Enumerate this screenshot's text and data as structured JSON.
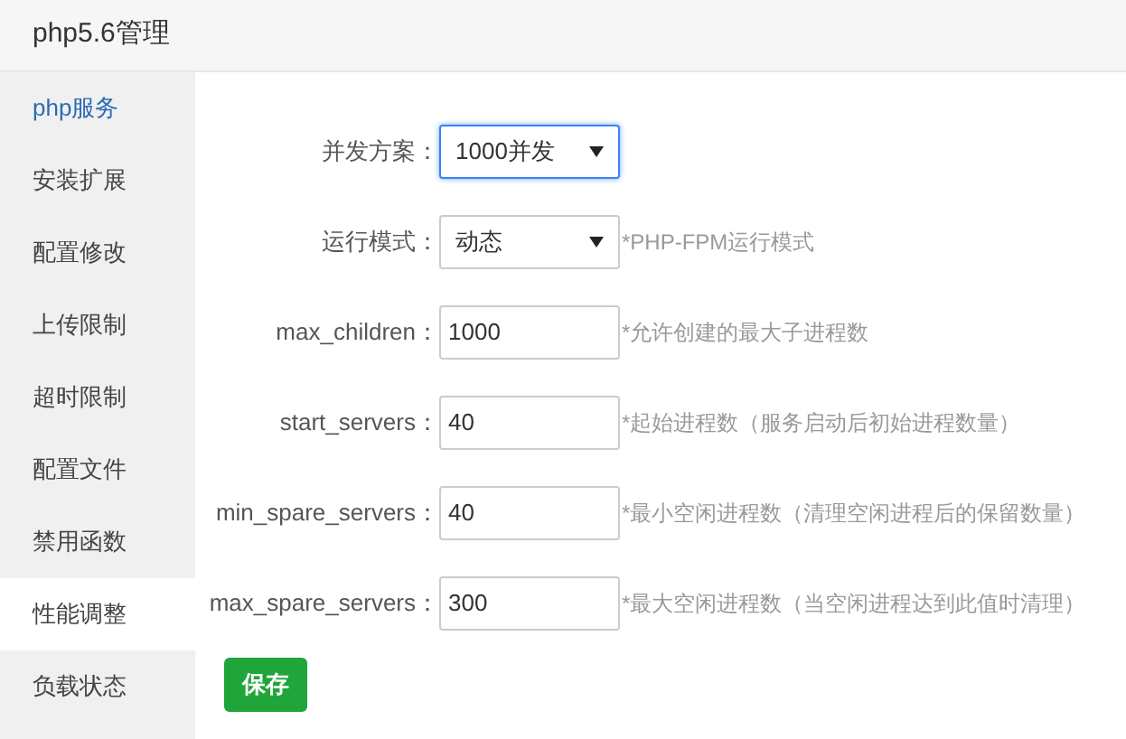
{
  "window": {
    "title": "php5.6管理"
  },
  "sidebar": {
    "items": [
      {
        "label": "php服务",
        "selected": false,
        "highlighted": true
      },
      {
        "label": "安装扩展",
        "selected": false,
        "highlighted": false
      },
      {
        "label": "配置修改",
        "selected": false,
        "highlighted": false
      },
      {
        "label": "上传限制",
        "selected": false,
        "highlighted": false
      },
      {
        "label": "超时限制",
        "selected": false,
        "highlighted": false
      },
      {
        "label": "配置文件",
        "selected": false,
        "highlighted": false
      },
      {
        "label": "禁用函数",
        "selected": false,
        "highlighted": false
      },
      {
        "label": "性能调整",
        "selected": true,
        "highlighted": false
      },
      {
        "label": "负载状态",
        "selected": false,
        "highlighted": false
      }
    ]
  },
  "form": {
    "fields": [
      {
        "kind": "select",
        "label": "并发方案：",
        "value": "1000并发",
        "focused": true
      },
      {
        "kind": "select",
        "label": "运行模式：",
        "value": "动态",
        "focused": false,
        "hint": "*PHP-FPM运行模式"
      },
      {
        "kind": "input",
        "label": "max_children：",
        "value": "1000",
        "focused": false,
        "hint": "*允许创建的最大子进程数"
      },
      {
        "kind": "input",
        "label": "start_servers：",
        "value": "40",
        "focused": false,
        "hint": "*起始进程数（服务启动后初始进程数量）"
      },
      {
        "kind": "input",
        "label": "min_spare_servers：",
        "value": "40",
        "focused": false,
        "hint": "*最小空闲进程数（清理空闲进程后的保留数量）"
      },
      {
        "kind": "input",
        "label": "max_spare_servers：",
        "value": "300",
        "focused": false,
        "hint": "*最大空闲进程数（当空闲进程达到此值时清理）"
      }
    ],
    "save_button": "保存"
  }
}
